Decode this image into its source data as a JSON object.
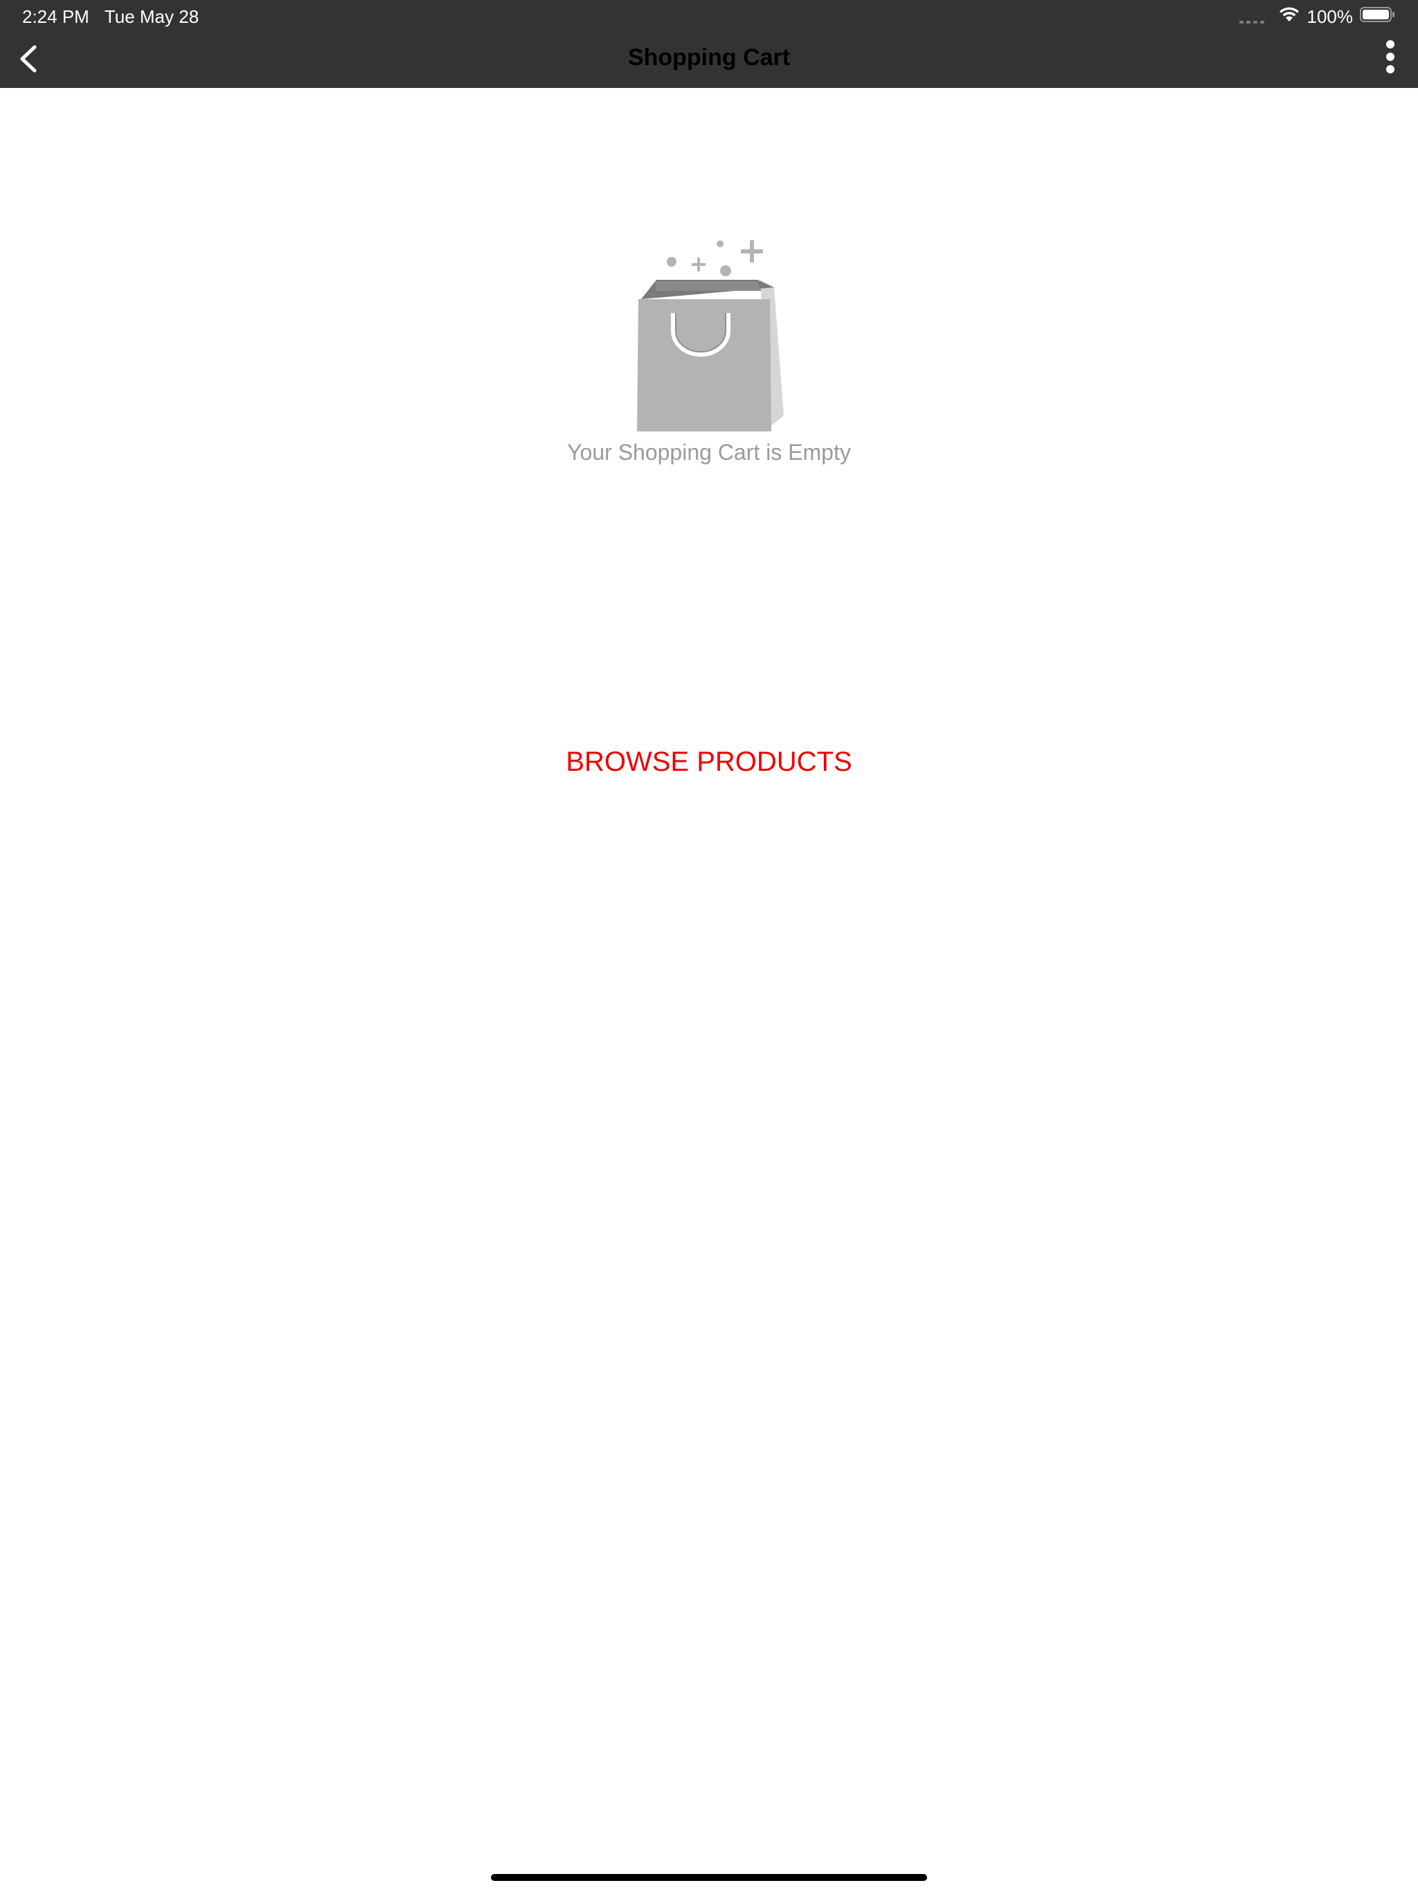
{
  "status_bar": {
    "time": "2:24 PM",
    "date": "Tue May 28",
    "battery": "100%"
  },
  "nav": {
    "title": "Shopping Cart"
  },
  "empty_state": {
    "message": "Your Shopping Cart is Empty",
    "action_label": "BROWSE PRODUCTS"
  },
  "icons": {
    "back": "chevron-left-icon",
    "more": "more-vertical-icon",
    "illustration": "shopping-bag-icon",
    "wifi": "wifi-icon",
    "battery": "battery-icon"
  },
  "colors": {
    "nav_background": "#333333",
    "accent": "#ee0000",
    "muted_text": "#9a9a9a",
    "illustration_gray": "#b3b3b3"
  }
}
